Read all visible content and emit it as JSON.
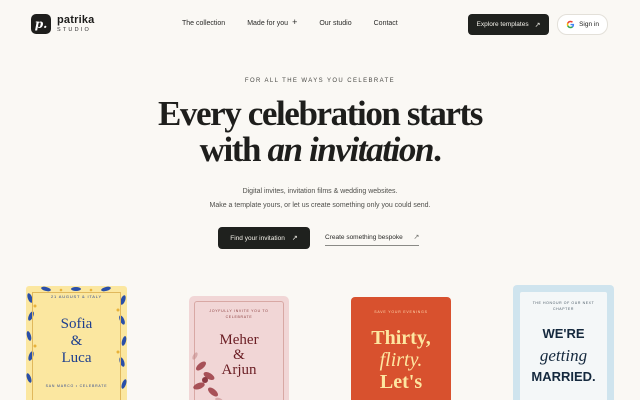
{
  "brand": {
    "name": "patrika",
    "sub": "STUDIO",
    "mark": "p."
  },
  "nav": {
    "items": [
      "The collection",
      "Made for you",
      "Our studio",
      "Contact"
    ],
    "made_for_you_symbol": "+"
  },
  "header_actions": {
    "explore_label": "Explore templates",
    "explore_arrow": "↗",
    "signin_label": "Sign in"
  },
  "hero": {
    "eyebrow": "FOR ALL THE WAYS YOU CELEBRATE",
    "headline_line1": "Every celebration starts",
    "headline_line2_plain": "with",
    "headline_line2_italic": "an invitation",
    "headline_line2_end": ".",
    "sub_line1": "Digital invites, invitation films & wedding websites.",
    "sub_line2": "Make a template yours, or let us create something only you could send.",
    "primary_cta": "Find your invitation",
    "primary_arrow": "↗",
    "secondary_cta": "Create something bespoke",
    "secondary_arrow": "↗"
  },
  "cards": {
    "sofia": {
      "top": "21 AUGUST & ITALY",
      "name1": "Sofia",
      "amp": "&",
      "name2": "Luca",
      "bottom": "SAN MARCO • CELEBRATE"
    },
    "meher": {
      "top": "JOYFULLY INVITE YOU TO CELEBRATE",
      "name1": "Meher",
      "amp": "&",
      "name2": "Arjun"
    },
    "thirty": {
      "top": "SAVE YOUR EVENINGS",
      "line1": "Thirty,",
      "line2": "flirty.",
      "line3": "Let's"
    },
    "married": {
      "top": "THE HONOUR OF OUR NEXT CHAPTER",
      "line1": "WE'RE",
      "line2": "getting",
      "line3": "MARRIED."
    }
  },
  "colors": {
    "page_bg": "#faf8f4",
    "dark_button": "#1f211e",
    "card_yellow": "#fbe7a0",
    "card_pink": "#f1d6d6",
    "card_orange": "#d8512e",
    "card_blue": "#cfe4ee"
  },
  "icons": [
    "brand-logo-icon",
    "plus-icon",
    "arrow-up-right-icon",
    "google-icon",
    "floral-decoration-icon"
  ]
}
